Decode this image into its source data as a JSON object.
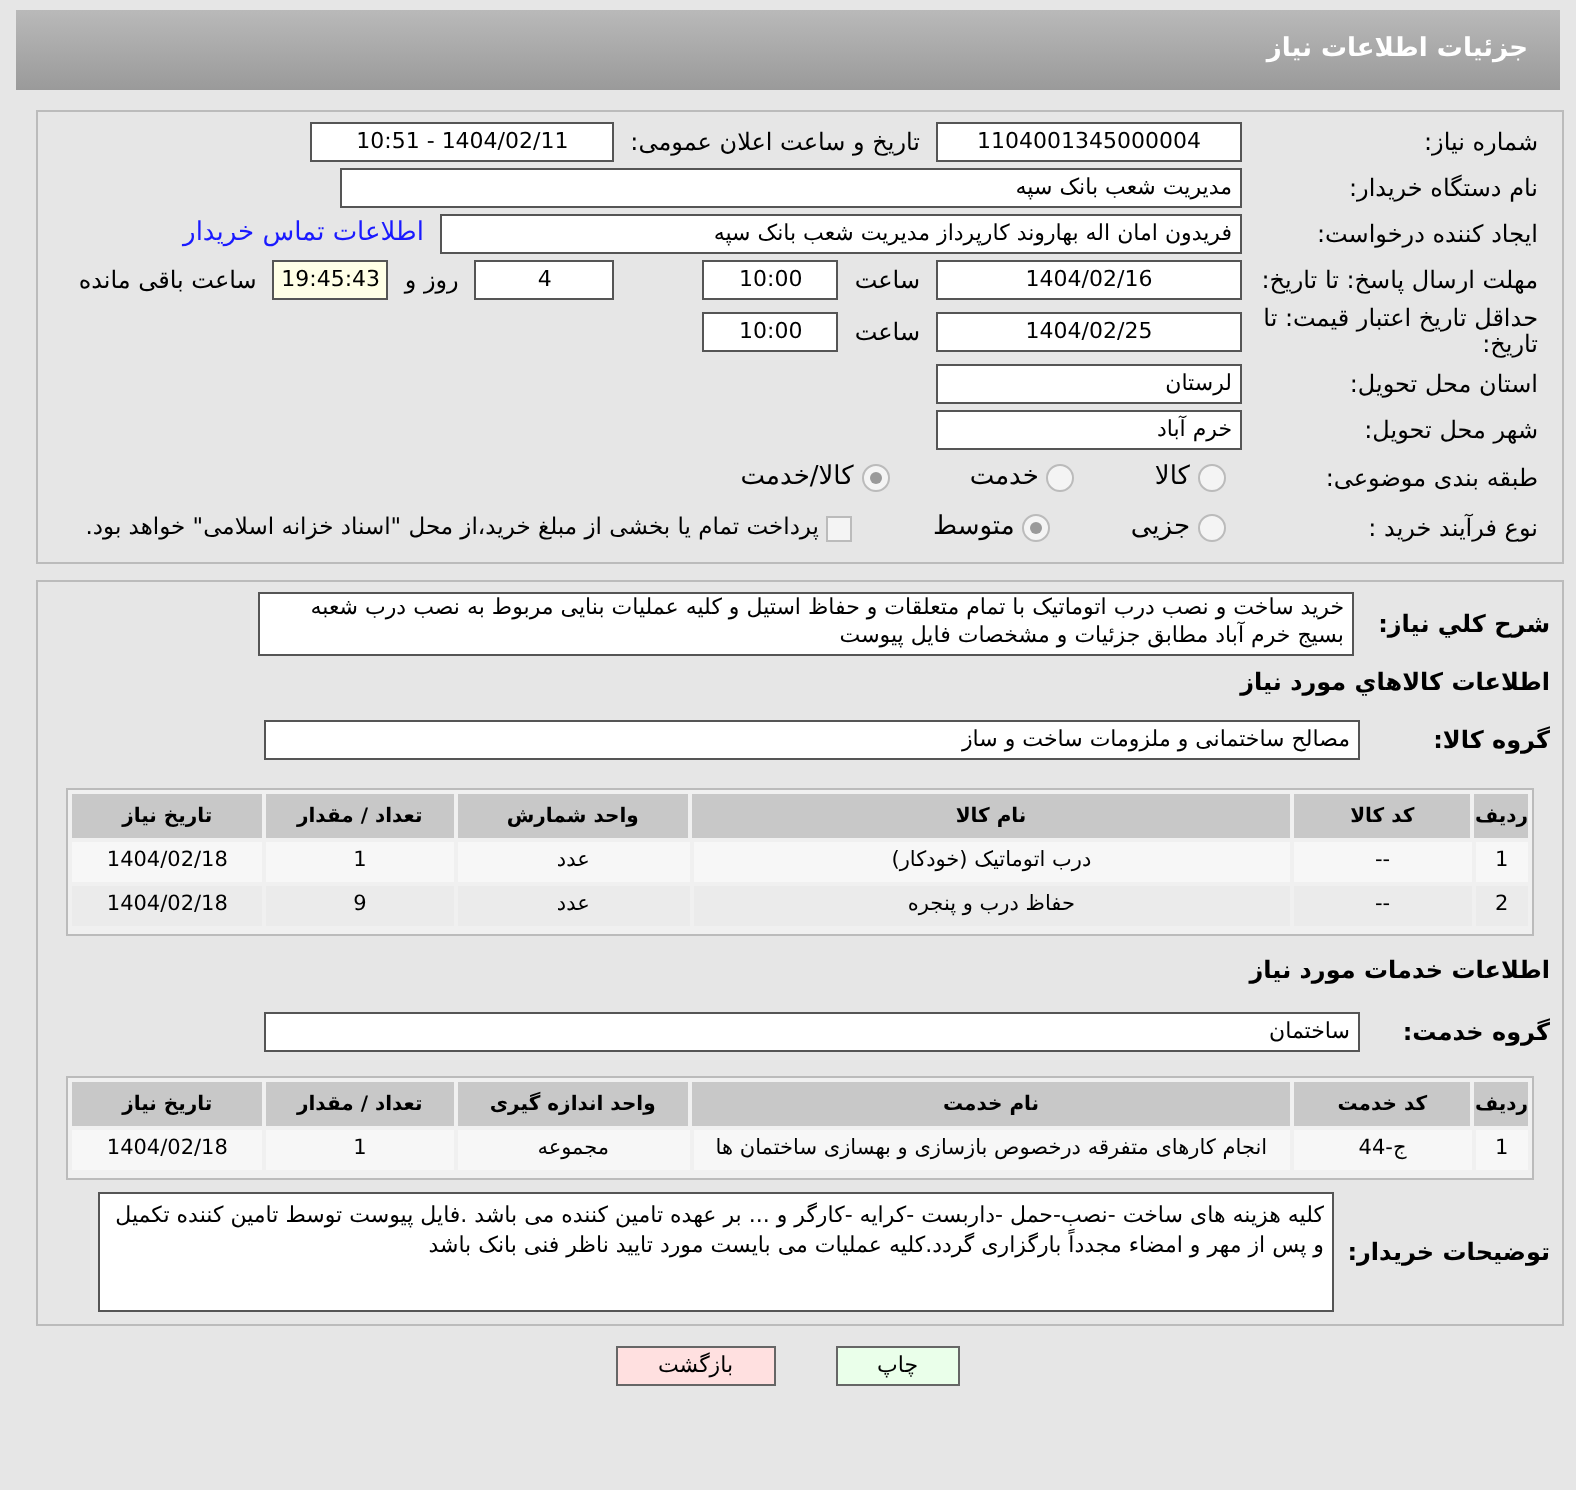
{
  "header": {
    "title": "جزئیات اطلاعات نیاز"
  },
  "need_number": {
    "label": "شماره نیاز:",
    "value": "1104001345000004"
  },
  "announce": {
    "label": "تاریخ و ساعت اعلان عمومی:",
    "value": "1404/02/11 - 10:51"
  },
  "buyer_org": {
    "label": "نام دستگاه خریدار:",
    "value": "مدیریت شعب بانک سپه"
  },
  "requester": {
    "label": "ایجاد کننده درخواست:",
    "value": "فریدون امان اله بهاروند کارپرداز مدیریت شعب بانک سپه",
    "link": "اطلاعات تماس خریدار"
  },
  "reply_deadline": {
    "label": "مهلت ارسال پاسخ: تا تاریخ:",
    "date": "1404/02/16",
    "time_label": "ساعت",
    "time": "10:00",
    "days": "4",
    "days_label": "روز و",
    "remaining": "19:45:43",
    "remaining_label": "ساعت باقی مانده"
  },
  "price_validity": {
    "label": "حداقل تاریخ اعتبار قیمت: تا تاریخ:",
    "date": "1404/02/25",
    "time_label": "ساعت",
    "time": "10:00"
  },
  "province": {
    "label": "استان محل تحویل:",
    "value": "لرستان"
  },
  "city": {
    "label": "شهر محل تحویل:",
    "value": "خرم آباد"
  },
  "category": {
    "label": "طبقه بندی موضوعی:",
    "options": [
      {
        "label": "کالا",
        "selected": false
      },
      {
        "label": "خدمت",
        "selected": false
      },
      {
        "label": "کالا/خدمت",
        "selected": true
      }
    ]
  },
  "purchase_type": {
    "label": "نوع فرآیند خرید :",
    "options": [
      {
        "label": "جزیی",
        "selected": false
      },
      {
        "label": "متوسط",
        "selected": true
      }
    ],
    "payment_note": {
      "label": "پرداخت تمام یا بخشی از مبلغ خرید،از محل \"اسناد خزانه اسلامی\" خواهد بود.",
      "checked": false
    }
  },
  "description": {
    "label": "شرح کلي نياز:",
    "text": "خرید ساخت و نصب درب اتوماتیک با تمام متعلقات و حفاظ استیل و کلیه عملیات بنایی مربوط به نصب درب شعبه بسیج خرم آباد مطابق جزئیات و مشخصات فایل پیوست"
  },
  "goods": {
    "heading": "اطلاعات کالاهاي مورد نياز",
    "group_label": "گروه کالا:",
    "group_value": "مصالح ساختمانی و ملزومات ساخت و ساز",
    "columns": [
      "ردیف",
      "کد کالا",
      "نام کالا",
      "واحد شمارش",
      "تعداد / مقدار",
      "تاریخ نیاز"
    ],
    "rows": [
      [
        "1",
        "--",
        "درب اتوماتیک (خودکار)",
        "عدد",
        "1",
        "1404/02/18"
      ],
      [
        "2",
        "--",
        "حفاظ درب و پنجره",
        "عدد",
        "9",
        "1404/02/18"
      ]
    ]
  },
  "services": {
    "heading": "اطلاعات خدمات مورد نیاز",
    "group_label": "گروه خدمت:",
    "group_value": "ساختمان",
    "columns": [
      "ردیف",
      "کد خدمت",
      "نام خدمت",
      "واحد اندازه گیری",
      "تعداد / مقدار",
      "تاریخ نیاز"
    ],
    "rows": [
      [
        "1",
        "ج-44",
        "انجام کارهای متفرقه درخصوص بازسازی و بهسازی ساختمان ها",
        "مجموعه",
        "1",
        "1404/02/18"
      ]
    ]
  },
  "buyer_notes": {
    "label": "توضیحات خریدار:",
    "text": "کلیه هزینه های ساخت -نصب-حمل -داربست -کرایه -کارگر و ... بر عهده تامین کننده می باشد .فایل پیوست توسط تامین کننده تکمیل و پس از مهر و امضاء مجدداً بارگزاری گردد.کلیه عملیات می بایست مورد تایید ناظر فنی بانک باشد"
  },
  "buttons": [
    {
      "label": "چاپ",
      "kind": "print"
    },
    {
      "label": "بازگشت",
      "kind": "back"
    }
  ]
}
